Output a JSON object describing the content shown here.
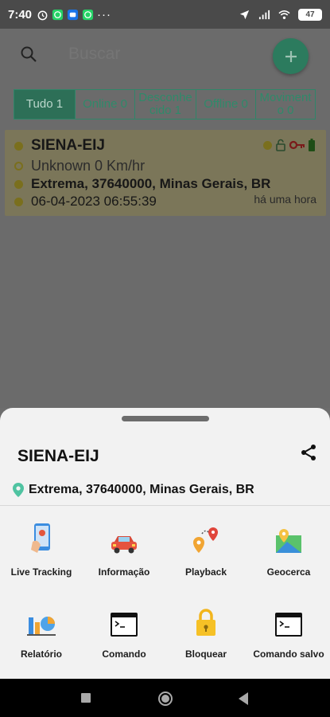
{
  "status_bar": {
    "time": "7:40",
    "battery": "47"
  },
  "search": {
    "placeholder": "Buscar"
  },
  "tabs": [
    {
      "label": "Tudo 1",
      "active": true
    },
    {
      "label": "Online 0",
      "active": false
    },
    {
      "label": "Desconhecido 1",
      "active": false
    },
    {
      "label": "Offline 0",
      "active": false
    },
    {
      "label": "Movimento 0",
      "active": false
    }
  ],
  "vehicle": {
    "name": "SIENA-EIJ",
    "speed": "Unknown 0 Km/hr",
    "address": "Extrema, 37640000, Minas Gerais, BR",
    "datetime": "06-04-2023 06:55:39",
    "ago": "há uma hora"
  },
  "sheet": {
    "title": "SIENA-EIJ",
    "address": "Extrema, 37640000, Minas Gerais, BR",
    "actions": [
      {
        "label": "Live Tracking",
        "icon": "live-tracking-icon"
      },
      {
        "label": "Informação",
        "icon": "car-info-icon"
      },
      {
        "label": "Playback",
        "icon": "playback-route-icon"
      },
      {
        "label": "Geocerca",
        "icon": "geofence-map-icon"
      },
      {
        "label": "Relatório",
        "icon": "report-chart-icon"
      },
      {
        "label": "Comando",
        "icon": "terminal-icon"
      },
      {
        "label": "Bloquear",
        "icon": "padlock-icon"
      },
      {
        "label": "Comando salvo",
        "icon": "saved-terminal-icon"
      }
    ]
  },
  "colors": {
    "accent": "#2f8669",
    "sheet_bg": "#f2f2f2",
    "card_bg": "#7b7659"
  }
}
